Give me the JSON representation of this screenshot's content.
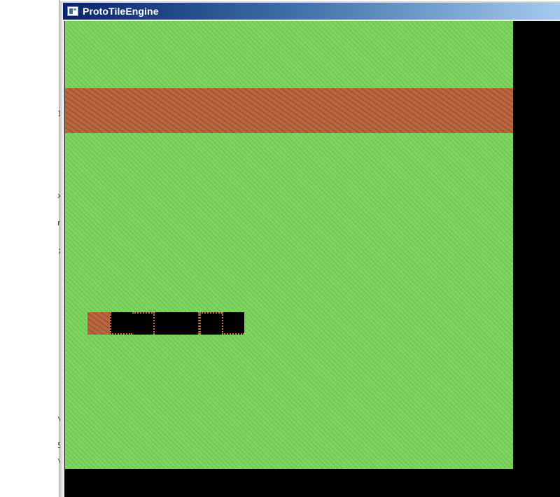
{
  "window": {
    "title": "ProtoTileEngine",
    "icon": "app-window-icon"
  },
  "background_window": {
    "glyphs": [
      "1",
      "x",
      "n",
      ";",
      "\\",
      "5",
      "\\"
    ]
  },
  "map": {
    "terrain": [
      "grass",
      "dirt-road"
    ],
    "tiles": [
      "dirt",
      "black",
      "black",
      "black",
      "black",
      "black",
      "black"
    ]
  },
  "colors": {
    "grass": "#7cd65f",
    "dirt": "#b9653f",
    "void": "#000000",
    "titlebar_start": "#0a246a",
    "titlebar_end": "#a6caf0"
  }
}
